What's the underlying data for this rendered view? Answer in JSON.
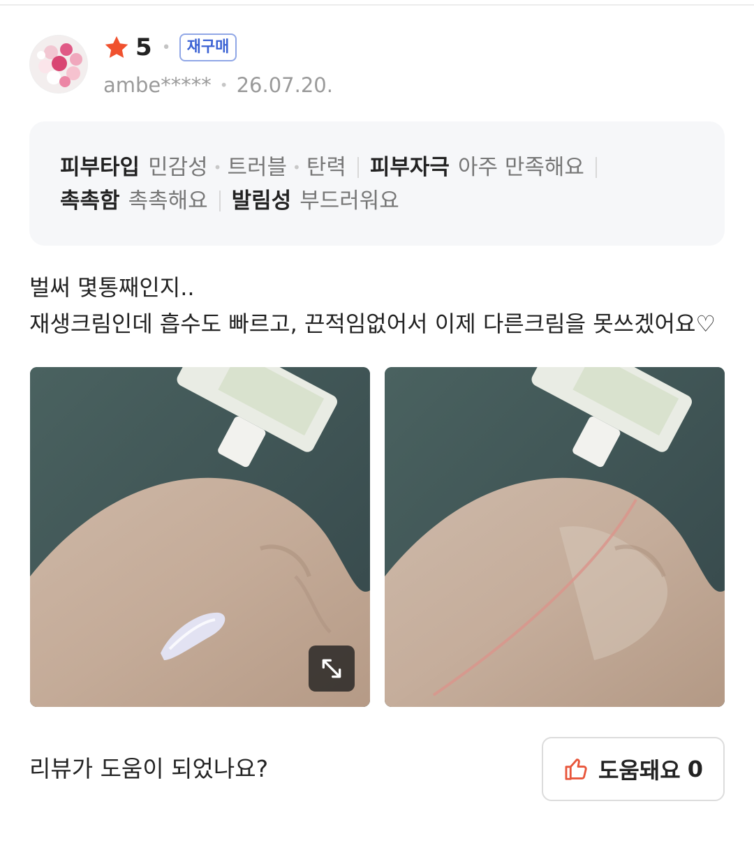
{
  "review": {
    "rating": "5",
    "repurchase_badge": "재구매",
    "username": "ambe*****",
    "date": "26.07.20.",
    "skin_info": {
      "line1": {
        "skin_type_label": "피부타입",
        "skin_types": [
          "민감성",
          "트러블",
          "탄력"
        ],
        "irritation_label": "피부자극",
        "irritation_value": "아주 만족해요"
      },
      "line2": {
        "moisture_label": "촉촉함",
        "moisture_value": "촉촉해요",
        "spread_label": "발림성",
        "spread_value": "부드러워요"
      }
    },
    "body_lines": [
      "벌써 몇통째인지..",
      "재생크림인데 흡수도 빠르고, 끈적임없어서 이제 다른크림을 못쓰겠어요♡"
    ]
  },
  "footer": {
    "question": "리뷰가 도움이 되었나요?",
    "helpful_label": "도움돼요",
    "helpful_count": "0"
  },
  "icons": {
    "star": "star-icon",
    "expand": "expand-icon",
    "thumbs_up": "thumbs-up-icon"
  },
  "colors": {
    "star": "#f0512e",
    "badge_border": "#8fa6e6",
    "badge_text": "#3c63d4",
    "thumbs_up": "#e8553a",
    "info_box_bg": "#f6f7f9"
  }
}
